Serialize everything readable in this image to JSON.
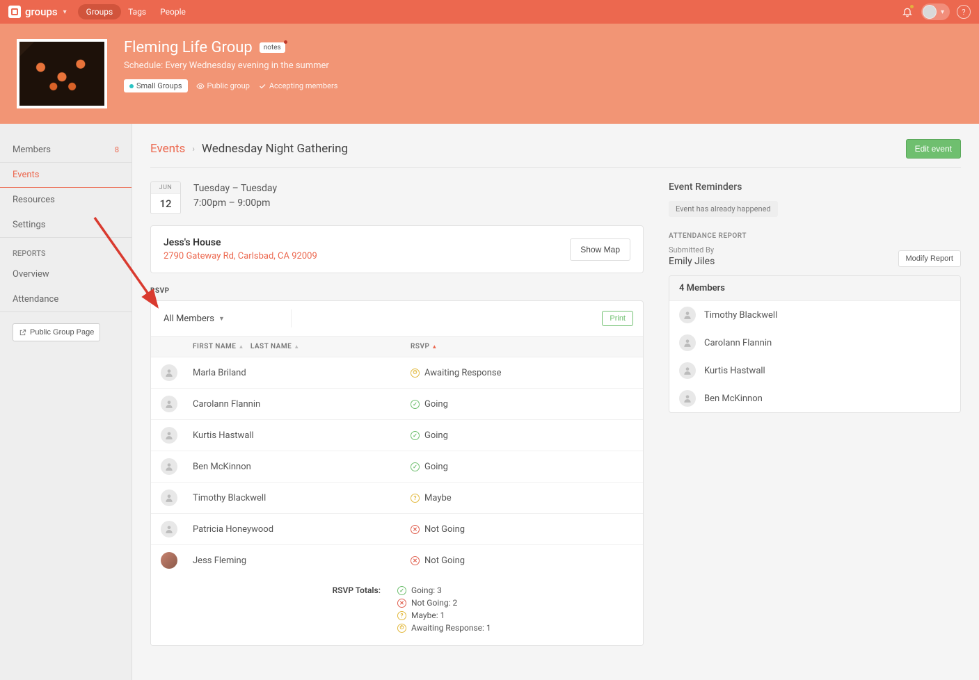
{
  "topbar": {
    "brand": "groups",
    "nav": [
      "Groups",
      "Tags",
      "People"
    ]
  },
  "group": {
    "title": "Fleming Life Group",
    "notes_badge": "notes",
    "schedule": "Schedule: Every Wednesday evening in the summer",
    "tag": "Small Groups",
    "visibility": "Public group",
    "accepting": "Accepting members"
  },
  "sidebar": {
    "members": {
      "label": "Members",
      "count": "8"
    },
    "events": "Events",
    "resources": "Resources",
    "settings": "Settings",
    "reports": "REPORTS",
    "overview": "Overview",
    "attendance": "Attendance",
    "public_btn": "Public Group Page"
  },
  "breadcrumb": {
    "root": "Events",
    "current": "Wednesday Night Gathering",
    "edit": "Edit event"
  },
  "event": {
    "month": "JUN",
    "day": "12",
    "date_range": "Tuesday – Tuesday",
    "time_range": "7:00pm – 9:00pm",
    "location_name": "Jess's House",
    "location_addr": "2790 Gateway Rd, Carlsbad, CA 92009",
    "show_map": "Show Map"
  },
  "rsvp": {
    "section": "RSVP",
    "filter": "All Members",
    "print": "Print",
    "cols": {
      "first": "FIRST NAME",
      "last": "LAST NAME",
      "rsvp": "RSVP"
    },
    "rows": [
      {
        "name": "Marla Briland",
        "status": "Awaiting Response",
        "k": "a"
      },
      {
        "name": "Carolann Flannin",
        "status": "Going",
        "k": "g"
      },
      {
        "name": "Kurtis Hastwall",
        "status": "Going",
        "k": "g"
      },
      {
        "name": "Ben McKinnon",
        "status": "Going",
        "k": "g"
      },
      {
        "name": "Timothy Blackwell",
        "status": "Maybe",
        "k": "m"
      },
      {
        "name": "Patricia Honeywood",
        "status": "Not Going",
        "k": "n"
      },
      {
        "name": "Jess Fleming",
        "status": "Not Going",
        "k": "n",
        "img": true
      }
    ],
    "totals_label": "RSVP Totals:",
    "totals": [
      {
        "t": "Going: 3",
        "k": "g"
      },
      {
        "t": "Not Going: 2",
        "k": "n"
      },
      {
        "t": "Maybe: 1",
        "k": "m"
      },
      {
        "t": "Awaiting Response: 1",
        "k": "a"
      }
    ]
  },
  "reminders": {
    "title": "Event Reminders",
    "pill": "Event has already happened",
    "ar_label": "ATTENDANCE REPORT",
    "submitted_by": "Submitted By",
    "submitter": "Emily Jiles",
    "modify": "Modify Report",
    "members_label": "4 Members",
    "members": [
      "Timothy Blackwell",
      "Carolann Flannin",
      "Kurtis Hastwall",
      "Ben McKinnon"
    ]
  }
}
